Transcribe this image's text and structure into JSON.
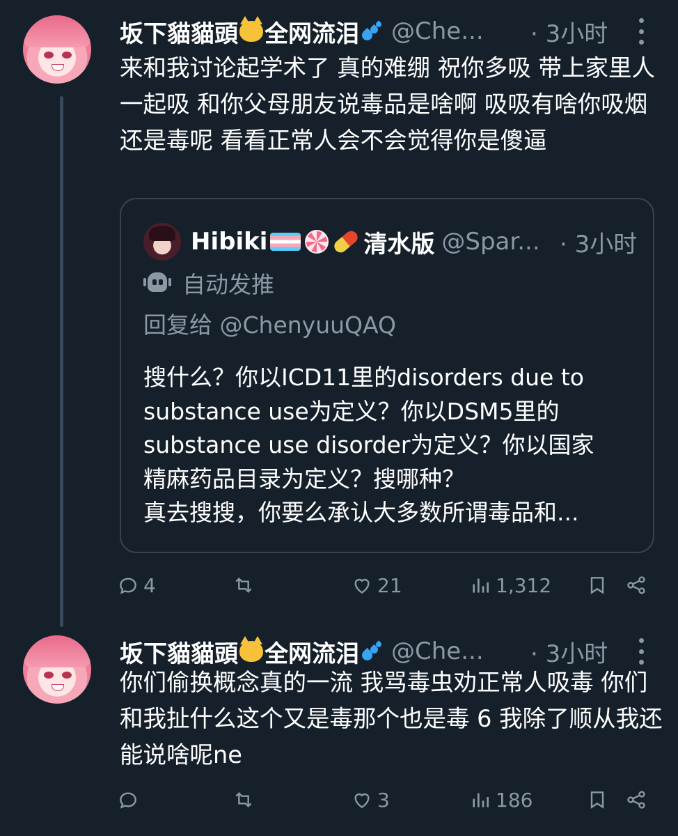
{
  "tweets": [
    {
      "display_name": "坂下貓貓頭",
      "display_name_suffix": "全网流泪",
      "emojis": [
        "cat-face-emoji",
        "sweat-droplets-emoji"
      ],
      "handle": "@Che...",
      "time": "· 3小时",
      "text": "来和我讨论起学术了 真的难绷 祝你多吸 带上家里人一起吸 和你父母朋友说毒品是啥啊 吸吸有啥你吸烟还是毒呢 看看正常人会不会觉得你是傻逼",
      "quote": {
        "display_name": "Hibiki",
        "display_name_suffix": "清水版",
        "emojis": [
          "transgender-flag-emoji",
          "fish-cake-emoji",
          "pill-emoji"
        ],
        "handle": "@Spar...",
        "time": "· 3小时",
        "automated_label": "自动发推",
        "reply_to": "回复给 @ChenyuuQAQ",
        "text_lines": [
          "搜什么？你以ICD11里的disorders due to",
          "substance use为定义？你以DSM5里的",
          "substance use disorder为定义？你以国家",
          "精麻药品目录为定义？搜哪种？",
          "真去搜搜，你要么承认大多数所谓毒品和..."
        ]
      },
      "actions": {
        "replies": "4",
        "retweets": "",
        "likes": "21",
        "views": "1,312"
      }
    },
    {
      "display_name": "坂下貓貓頭",
      "display_name_suffix": "全网流泪",
      "emojis": [
        "cat-face-emoji",
        "sweat-droplets-emoji"
      ],
      "handle": "@Che...",
      "time": "· 3小时",
      "text": "你们偷换概念真的一流 我骂毒虫劝正常人吸毒 你们和我扯什么这个又是毒那个也是毒 6 我除了顺从我还能说啥呢ne",
      "actions": {
        "replies": "",
        "retweets": "",
        "likes": "3",
        "views": "186"
      }
    }
  ],
  "colors": {
    "background": "#15202b",
    "text": "#ffffff",
    "secondary": "#8b98a5",
    "border": "#38444d"
  }
}
